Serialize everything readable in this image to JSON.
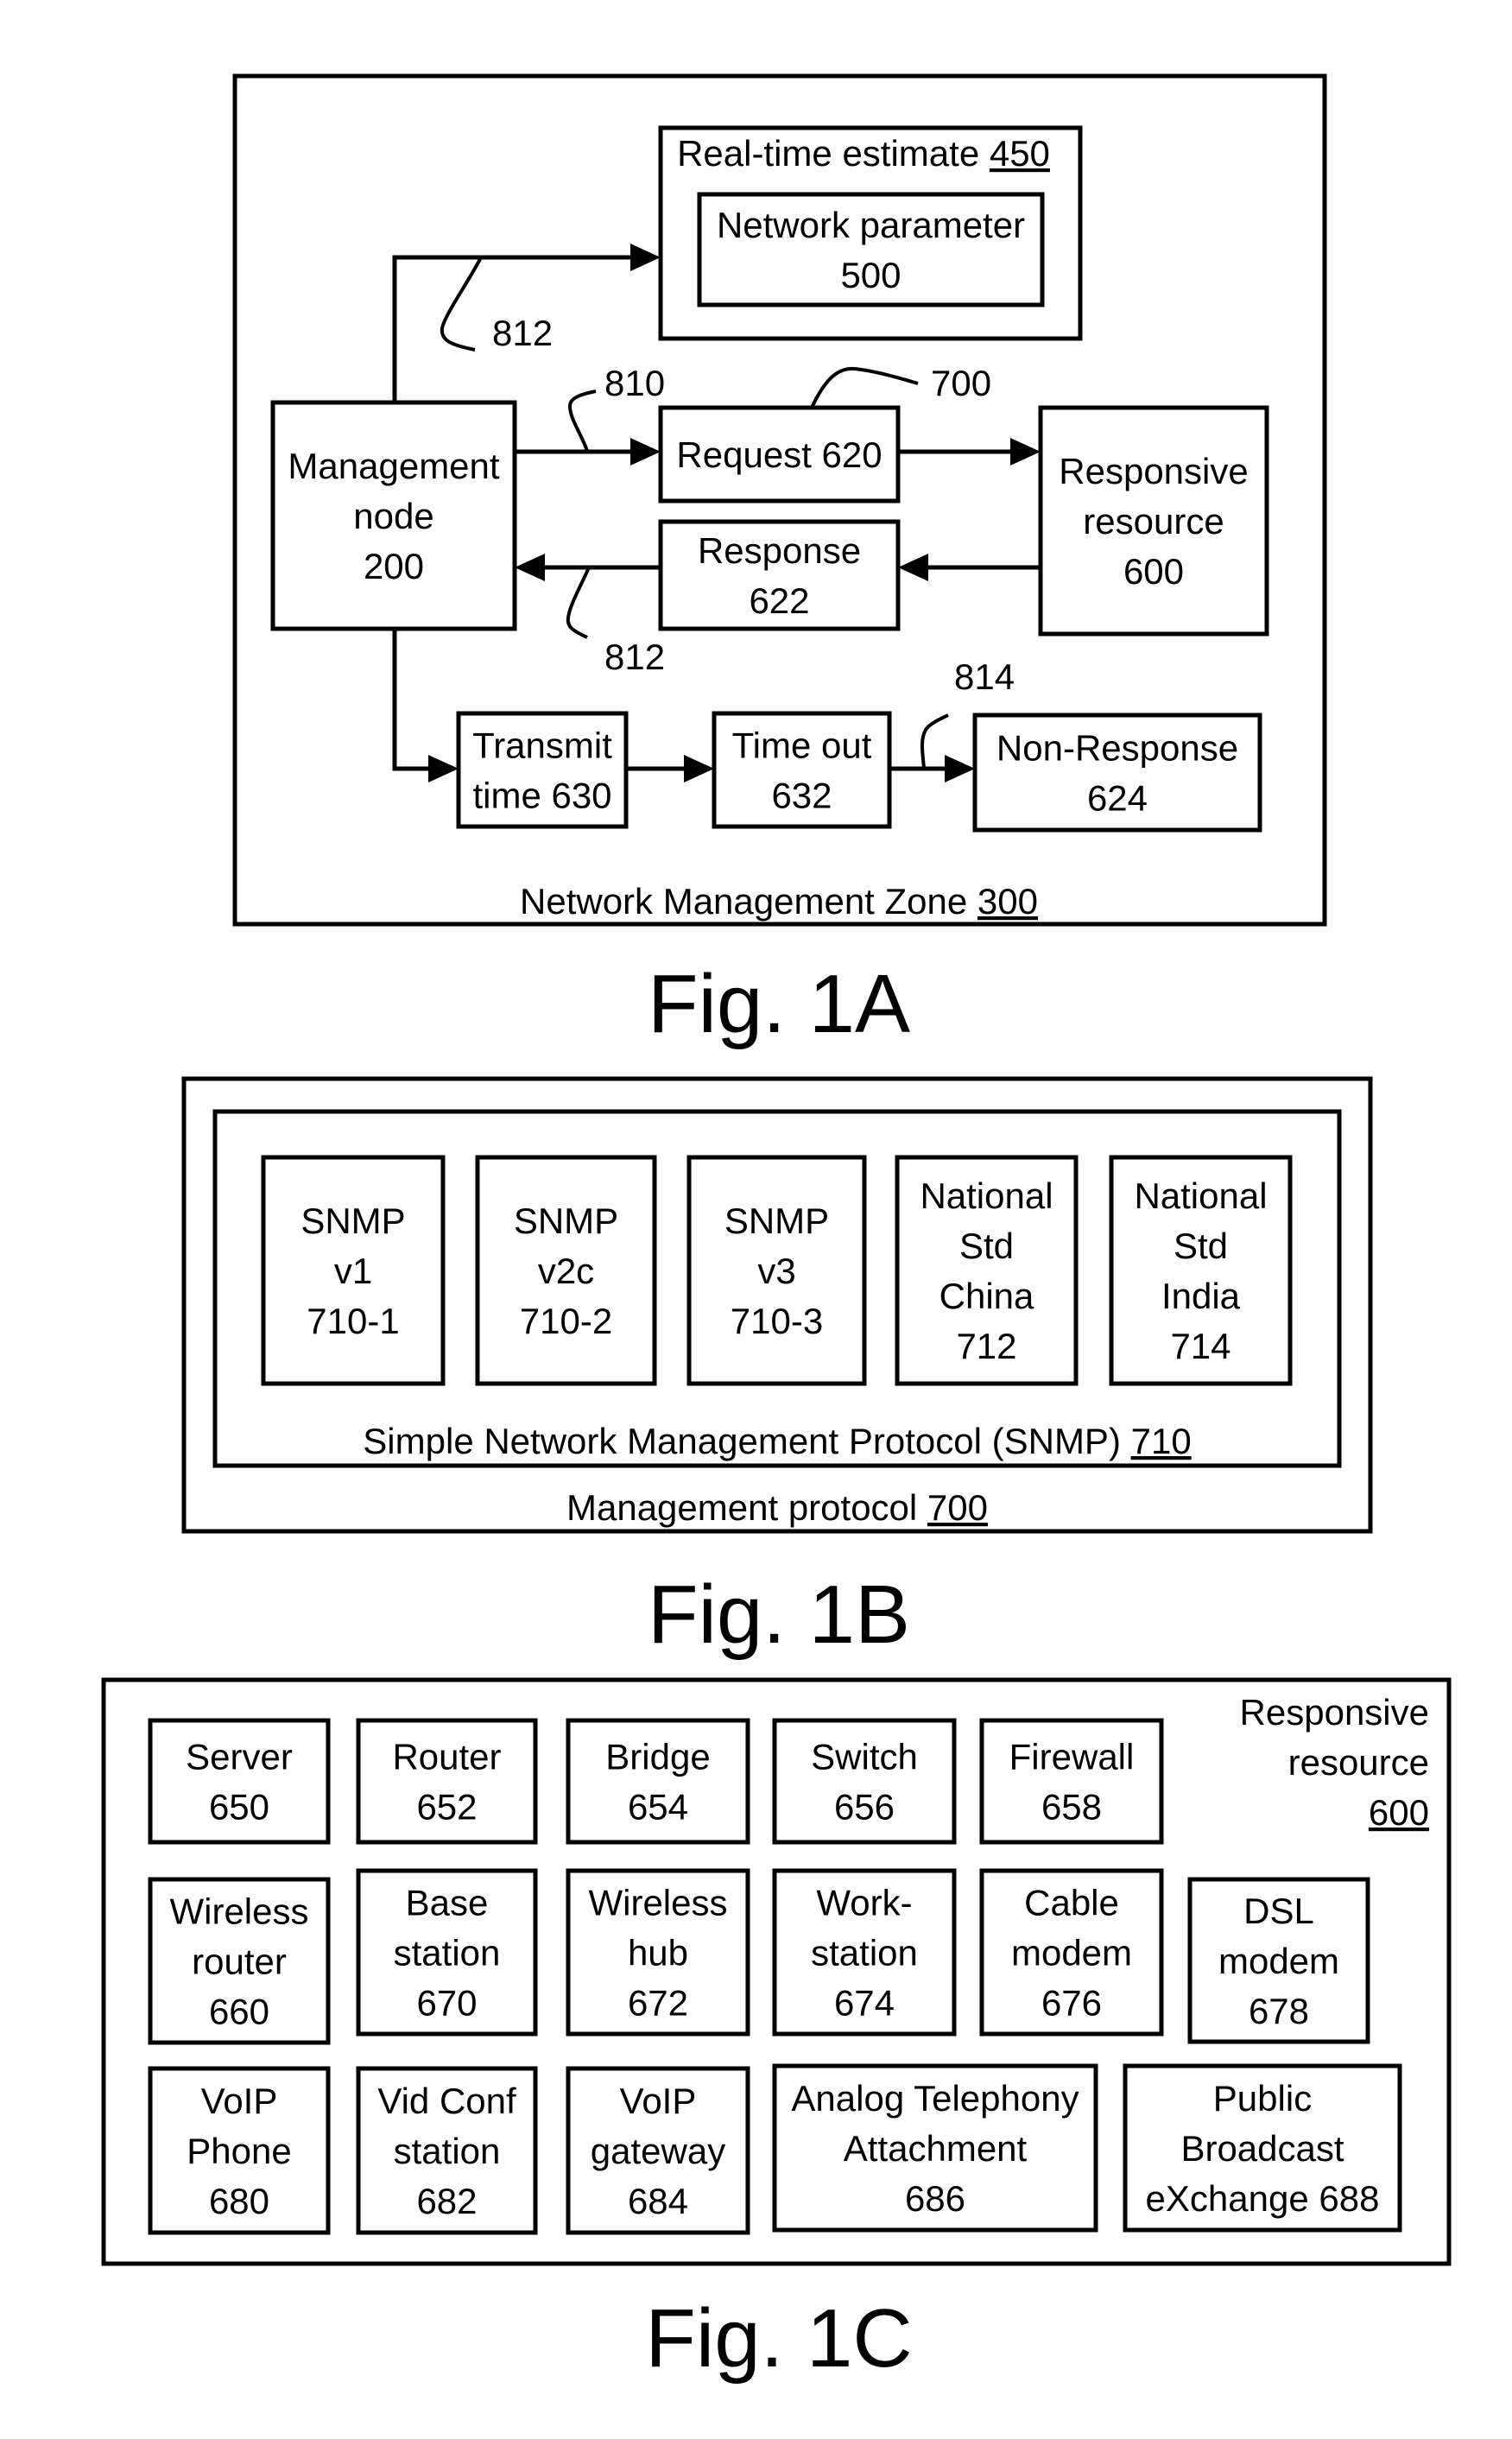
{
  "fig1a": {
    "caption": "Fig. 1A",
    "zone": {
      "text": "Network Management Zone ",
      "ref": "300"
    },
    "realtime": {
      "text": "Real-time estimate ",
      "ref": "450"
    },
    "network_parameter": [
      "Network parameter",
      "500"
    ],
    "management_node": [
      "Management",
      "node",
      "200"
    ],
    "request": [
      "Request 620"
    ],
    "response": [
      "Response",
      "622"
    ],
    "responsive_resource": [
      "Responsive",
      "resource",
      "600"
    ],
    "transmit_time": [
      "Transmit",
      "time 630"
    ],
    "time_out": [
      "Time out",
      "632"
    ],
    "non_response": [
      "Non-Response",
      "624"
    ],
    "callouts": {
      "c812_top": "812",
      "c810": "810",
      "c700": "700",
      "c812_bottom": "812",
      "c814": "814"
    }
  },
  "fig1b": {
    "caption": "Fig. 1B",
    "outer": {
      "text": "Management protocol ",
      "ref": "700"
    },
    "inner": {
      "text": "Simple Network Management Protocol (SNMP) ",
      "ref": "710"
    },
    "boxes": [
      [
        "SNMP",
        "v1",
        "710-1"
      ],
      [
        "SNMP",
        "v2c",
        "710-2"
      ],
      [
        "SNMP",
        "v3",
        "710-3"
      ],
      [
        "National",
        "Std",
        "China",
        "712"
      ],
      [
        "National",
        "Std",
        "India",
        "714"
      ]
    ]
  },
  "fig1c": {
    "caption": "Fig. 1C",
    "title": [
      "Responsive",
      "resource"
    ],
    "title_ref": "600",
    "rows": [
      [
        [
          "Server",
          "650"
        ],
        [
          "Router",
          "652"
        ],
        [
          "Bridge",
          "654"
        ],
        [
          "Switch",
          "656"
        ],
        [
          "Firewall",
          "658"
        ]
      ],
      [
        [
          "Wireless",
          "router",
          "660"
        ],
        [
          "Base",
          "station",
          "670"
        ],
        [
          "Wireless",
          "hub",
          "672"
        ],
        [
          "Work-",
          "station",
          "674"
        ],
        [
          "Cable",
          "modem",
          "676"
        ],
        [
          "DSL",
          "modem",
          "678"
        ]
      ],
      [
        [
          "VoIP",
          "Phone",
          "680"
        ],
        [
          "Vid Conf",
          "station",
          "682"
        ],
        [
          "VoIP",
          "gateway",
          "684"
        ],
        [
          "Analog Telephony",
          "Attachment",
          "686"
        ],
        [
          "Public",
          "Broadcast",
          "eXchange 688"
        ]
      ]
    ]
  }
}
